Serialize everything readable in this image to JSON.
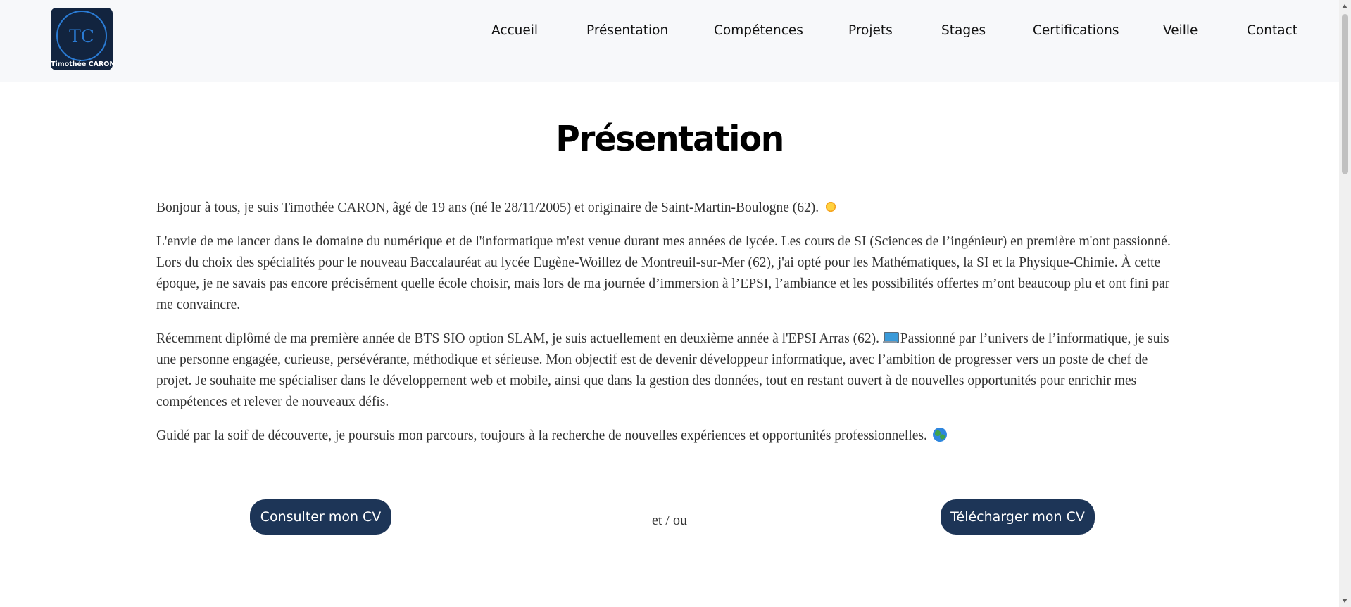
{
  "header": {
    "logo": {
      "initials": "TC",
      "name": "Timothée CARON"
    },
    "nav": [
      "Accueil",
      "Présentation",
      "Compétences",
      "Projets",
      "Stages",
      "Certifications",
      "Veille",
      "Contact"
    ]
  },
  "main": {
    "title": "Présentation",
    "paragraphs": [
      "Bonjour à tous, je suis Timothée CARON, âgé de 19 ans (né le 28/11/2005) et originaire de Saint-Martin-Boulogne (62).",
      "L'envie de me lancer dans le domaine du numérique et de l'informatique m'est venue durant mes années de lycée. Les cours de SI (Sciences de l’ingénieur) en première m'ont passionné. Lors du choix des spécialités pour le nouveau Baccalauréat au lycée Eugène-Woillez de Montreuil-sur-Mer (62), j'ai opté pour les Mathématiques, la SI et la Physique-Chimie. À cette époque, je ne savais pas encore précisément quelle école choisir, mais lors de ma journée d’immersion à l’EPSI, l’ambiance et les possibilités offertes m’ont beaucoup plu et ont fini par me convaincre.",
      "Récemment diplômé de ma première année de BTS SIO option SLAM, je suis actuellement en deuxième année à l'EPSI Arras (62).",
      "Passionné par l’univers de l’informatique, je suis une personne engagée, curieuse, persévérante, méthodique et sérieuse. Mon objectif est de devenir développeur informatique, avec l’ambition de progresser vers un poste de chef de projet. Je souhaite me spécialiser dans le développement web et mobile, ainsi que dans la gestion des données, tout en restant ouvert à de nouvelles opportunités pour enrichir mes compétences et relever de nouveaux défis.",
      "Guidé par la soif de découverte, je poursuis mon parcours, toujours à la recherche de nouvelles expériences et opportunités professionnelles."
    ],
    "icons": [
      "sun-emoji",
      "computer-emoji",
      "globe-emoji"
    ],
    "buttons": {
      "consult": "Consulter mon CV",
      "separator": "et / ou",
      "download": "Télécharger mon CV"
    }
  },
  "colors": {
    "header_bg": "#f7f8fa",
    "button_bg": "#1d3557",
    "logo_bg": "#12243f",
    "logo_accent": "#2a7bd4",
    "text": "#333333"
  }
}
